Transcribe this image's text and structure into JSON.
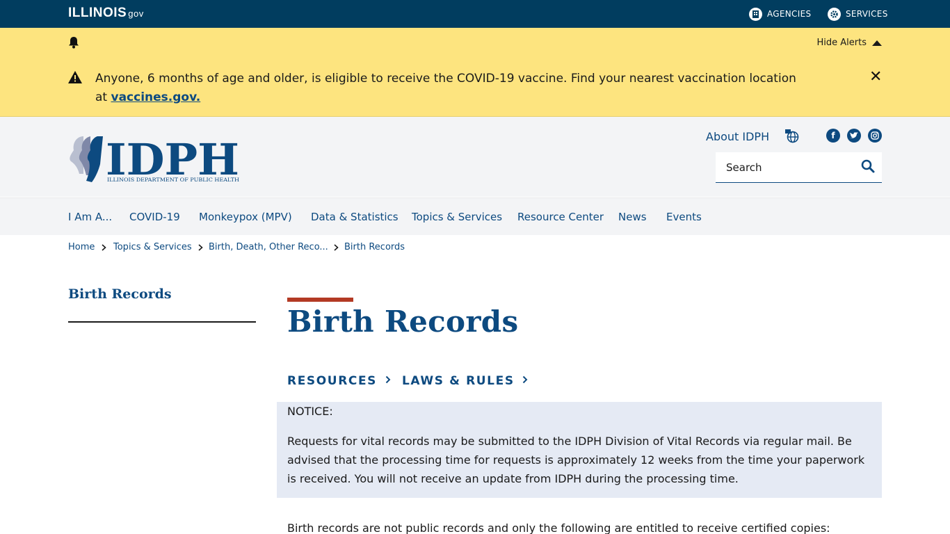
{
  "topbar": {
    "logo_main": "ILLINOIS",
    "logo_suffix": "gov",
    "agencies_label": "AGENCIES",
    "services_label": "SERVICES"
  },
  "alert": {
    "hide_label": "Hide Alerts",
    "message": "Anyone, 6 months of age and older, is eligible to receive the COVID-19 vaccine. Find your nearest vaccination location at ",
    "link_text": "vaccines.gov."
  },
  "header": {
    "logo_text": "IDPH",
    "logo_subtitle": "ILLINOIS DEPARTMENT OF PUBLIC HEALTH",
    "about_label": "About IDPH",
    "search_placeholder": "Search"
  },
  "nav": {
    "items": [
      "I Am A...",
      "COVID-19",
      "Monkeypox (MPV)",
      "Data & Statistics",
      "Topics & Services",
      "Resource Center",
      "News",
      "Events"
    ]
  },
  "breadcrumb": {
    "items": [
      "Home",
      "Topics & Services",
      "Birth, Death, Other Reco...",
      "Birth Records"
    ]
  },
  "sidebar": {
    "title": "Birth Records"
  },
  "main": {
    "title": "Birth Records",
    "resources_label": "RESOURCES",
    "laws_label": "LAWS & RULES",
    "notice_heading": "NOTICE:",
    "notice_body": "Requests for vital records may be submitted to the IDPH Division of Vital Records via regular mail. Be advised that the processing time for requests is approximately 12 weeks from the time your paperwork is received. You will not receive an update from IDPH during the processing time.",
    "body_text": "Birth records are not public records and only the following are entitled to receive certified copies:"
  },
  "colors": {
    "topbar_bg": "#013d5f",
    "alert_bg": "#fde47f",
    "header_bg": "#f3f4f6",
    "brand_blue": "#0d4a80",
    "accent_red": "#b33a24",
    "notice_bg": "#e5eaf4"
  },
  "icons": {
    "agencies": "building-icon",
    "services": "gear-icon",
    "alerts": "bell-icon",
    "warning": "warning-triangle-icon",
    "close": "close-icon",
    "language": "globe-icon",
    "search": "search-icon",
    "facebook": "facebook-icon",
    "twitter": "twitter-icon",
    "instagram": "instagram-icon",
    "chevron": "chevron-right-icon"
  }
}
